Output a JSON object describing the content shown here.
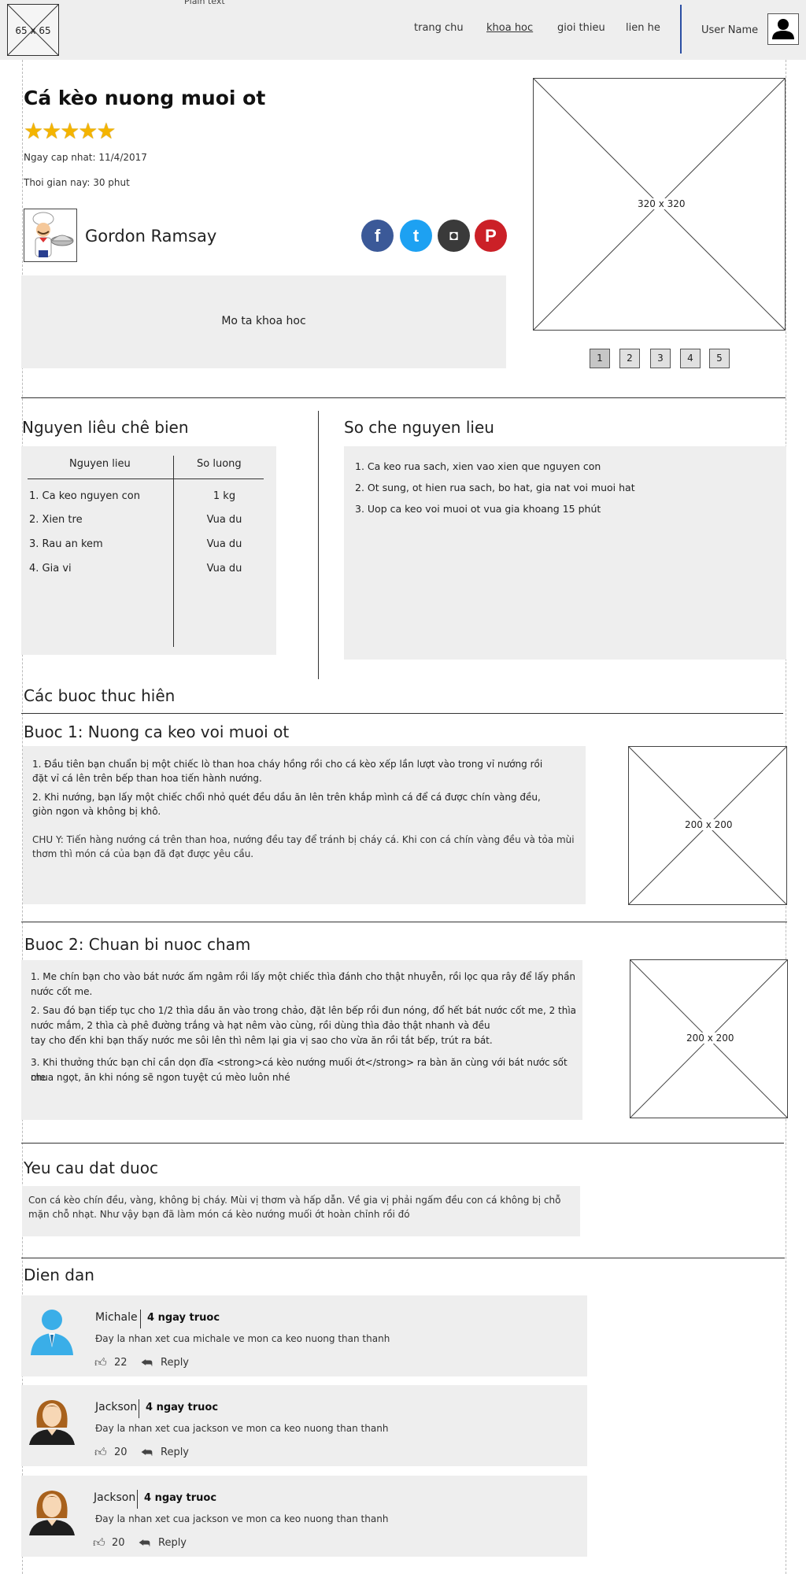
{
  "header": {
    "plain_text": "Plain text",
    "logo_label": "65 x 65",
    "nav": [
      "trang chu",
      "khoa hoc",
      "gioi thieu",
      "lien he"
    ],
    "user_name": "User Name"
  },
  "recipe": {
    "title": "Cá kèo nuong muoi ot",
    "rating": 5,
    "stars": "★★★★★",
    "updated": "Ngay cap nhat: 11/4/2017",
    "cook_time": "Thoi gian nay: 30 phut",
    "chef_name": "Gordon Ramsay",
    "social": [
      "f",
      "t",
      "◘",
      "P"
    ],
    "description": "Mo ta khoa hoc",
    "hero_image_label": "320 x 320",
    "pages": [
      "1",
      "2",
      "3",
      "4",
      "5"
    ]
  },
  "ingredients": {
    "heading": "Nguyen liêu chê  bien",
    "col_name": "Nguyen lieu",
    "col_qty": "So luong",
    "rows": [
      {
        "name": "1. Ca keo nguyen con",
        "qty": "1 kg"
      },
      {
        "name": "2. Xien tre",
        "qty": "Vua du"
      },
      {
        "name": "3. Rau an kem",
        "qty": "Vua du"
      },
      {
        "name": "4. Gia vi",
        "qty": "Vua du"
      }
    ]
  },
  "prep": {
    "heading": "So che nguyen lieu",
    "steps": [
      "1. Ca keo rua sach, xien vao xien que nguyen con",
      "2. Ot sung, ot hien rua sach, bo hat, gia nat voi muoi hat",
      "3. Uop ca keo voi muoi ot vua gia khoang 15 phút"
    ]
  },
  "procedure": {
    "heading": "Các buoc thuc hiên",
    "step1": {
      "title": "Buoc 1: Nuong ca keo voi muoi ot",
      "p1a": "1. Đầu tiên bạn chuẩn bị một chiếc lò than hoa cháy hồng rồi cho cá kèo xếp lần lượt vào trong vỉ nướng rồi",
      "p1b": "đặt vỉ cá lên trên bếp than hoa tiến hành nướng.",
      "p2a": "2. Khi nướng, bạn lấy một chiếc chổi nhỏ quét đều dầu ăn lên trên khắp mình cá để cá được chín vàng đều,",
      "p2b": "giòn ngon và không bị khô.",
      "n1": "CHU Y: Tiến hàng nướng cá trên than hoa, nướng đều tay để tránh bị cháy cá. Khi con cá chín vàng đều và tỏa mùi",
      "n2": "thơm thì món cá của bạn đã đạt được yêu cầu.",
      "image_label": "200 x 200"
    },
    "step2": {
      "title": "Buoc 2: Chuan bi nuoc cham",
      "p1a": "1. Me chín bạn cho vào bát nước ấm ngâm rồi lấy một chiếc thìa đánh cho thật nhuyễn, rồi lọc qua rây để lấy phần",
      "p1b": "nước cốt me.",
      "p2a": "2. Sau đó bạn tiếp tục cho 1/2 thìa dầu ăn vào trong chảo, đặt lên bếp rồi đun nóng, đổ hết bát nước cốt me, 2 thìa",
      "p2b": "nước mắm, 2 thìa cà phê đường trắng và hạt nêm vào cùng, rồi dùng thìa đảo thật nhanh và đều",
      "p2c": "tay cho đến khi bạn thấy nước me sôi lên thì nêm lại gia vị sao cho vừa ăn rồi tắt bếp, trút ra bát.",
      "p3a": "3. Khi thưởng thức bạn chỉ cần dọn đĩa <strong>cá kèo nướng muối ớt</strong> ra bàn ăn cùng với bát nước sốt me",
      "p3b": " chua ngọt, ăn khi nóng sẽ ngon tuyệt cú mèo luôn nhé",
      "image_label": "200 x 200"
    }
  },
  "requirement": {
    "heading": "Yeu cau dat duoc",
    "line1": "Con cá kèo chín đều, vàng, không bị cháy. Mùi vị thơm và hấp dẫn. Về gia vị phải ngấm đều con cá không bị chỗ",
    "line2": "mặn chỗ nhạt. Như vậy bạn đã làm món cá kèo nướng muối ớt hoàn chỉnh rồi đó"
  },
  "forum": {
    "heading": "Dien dan",
    "comments": [
      {
        "name": "Michale",
        "time": "4 ngay truoc",
        "text": "Đay la nhan xet cua michale ve mon ca keo nuong than thanh",
        "likes": "22",
        "reply": "Reply",
        "avatar": "male"
      },
      {
        "name": "Jackson",
        "time": "4 ngay truoc",
        "text": "Đay la nhan xet cua jackson ve mon ca keo nuong than thanh",
        "likes": "20",
        "reply": "Reply",
        "avatar": "female"
      },
      {
        "name": "Jackson",
        "time": "4 ngay truoc",
        "text": "Đay la nhan xet cua jackson ve mon ca keo nuong than thanh",
        "likes": "20",
        "reply": "Reply",
        "avatar": "female"
      }
    ]
  },
  "colors": {
    "header_bg": "#eeeeee",
    "panel_bg": "#eeeeee",
    "star": "#f4b400",
    "facebook": "#3b5998",
    "twitter": "#1da1f2",
    "instagram": "#3a3a3a",
    "pinterest": "#cb2027",
    "nav_divider": "#2b4ea3",
    "male_avatar": "#3aaee8"
  }
}
